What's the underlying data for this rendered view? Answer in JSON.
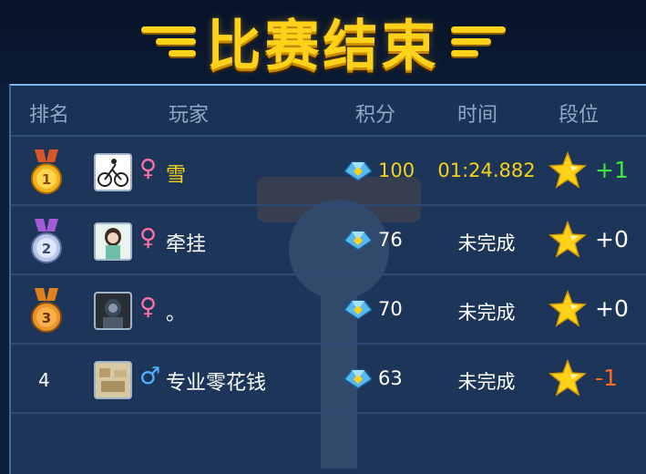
{
  "title": "比赛结束",
  "columns": {
    "rank": "排名",
    "player": "玩家",
    "score": "积分",
    "time": "时间",
    "tier": "段位"
  },
  "rows": [
    {
      "rank": "1",
      "gender": "♀",
      "name": "雪",
      "score": "100",
      "time": "01:24.882",
      "delta": "+1"
    },
    {
      "rank": "2",
      "gender": "♀",
      "name": "牵挂",
      "score": "76",
      "time": "未完成",
      "delta": "+0"
    },
    {
      "rank": "3",
      "gender": "♀",
      "name": "。",
      "score": "70",
      "time": "未完成",
      "delta": "+0"
    },
    {
      "rank": "4",
      "gender": "♂",
      "name": "专业零花钱",
      "score": "63",
      "time": "未完成",
      "delta": "-1"
    }
  ],
  "colors": {
    "title": "#ffd21a",
    "highlight": "#f2d21c",
    "positive": "#3bea3b",
    "negative": "#ff6a1a",
    "female": "#ff6fa8",
    "male": "#4fb3ff"
  }
}
